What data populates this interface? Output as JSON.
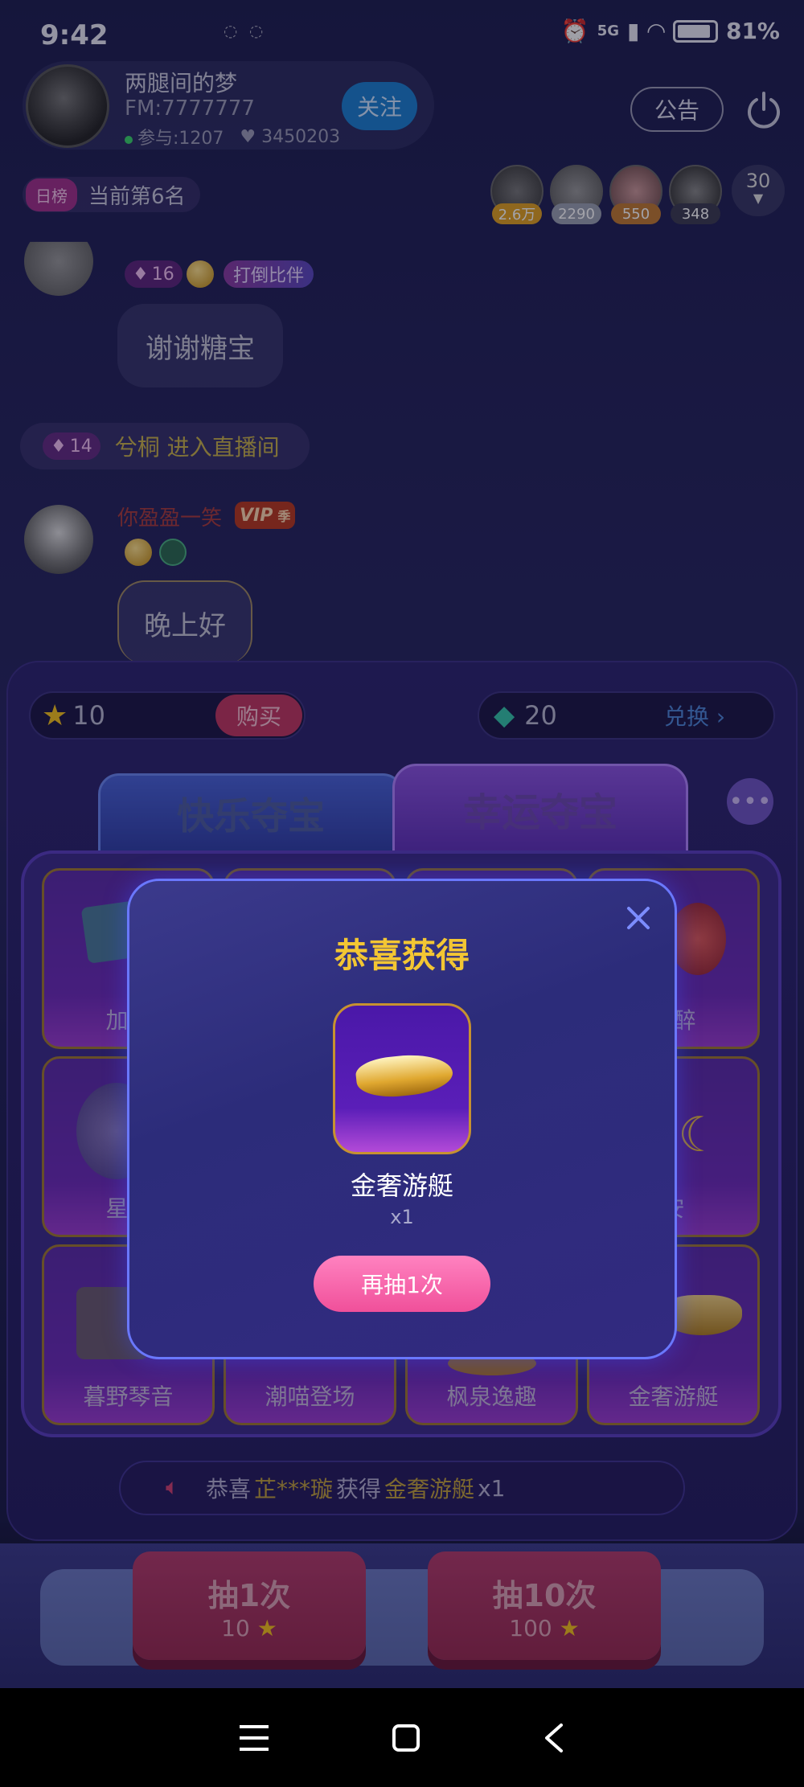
{
  "status_bar": {
    "time": "9:42",
    "network": "5G",
    "battery": "81%"
  },
  "host": {
    "name": "两腿间的梦",
    "fm": "FM:7777777",
    "participants": "参与:1207",
    "likes": "3450203",
    "follow_label": "关注"
  },
  "header": {
    "notice_label": "公告"
  },
  "rank": {
    "tag": "日榜",
    "text": "当前第6名"
  },
  "viewers": [
    {
      "badge": "2.6万",
      "badge_color": "#e0a020"
    },
    {
      "badge": "2290",
      "badge_color": "#9aa0b0"
    },
    {
      "badge": "550",
      "badge_color": "#c07a30"
    },
    {
      "badge": "348",
      "badge_color": "#3a3a50"
    }
  ],
  "online_count": "30",
  "chat": {
    "msg1": {
      "level": "16",
      "chip": "打倒比伴",
      "text": "谢谢糖宝"
    },
    "enter": {
      "level": "14",
      "text": "兮桐 进入直播间"
    },
    "msg2": {
      "user": "你盈盈一笑",
      "vip": "VIP",
      "vip_season": "季",
      "text": "晚上好"
    }
  },
  "game": {
    "stars": "10",
    "buy_label": "购买",
    "gems": "20",
    "exchange_label": "兑换",
    "tabs": [
      "快乐夺宝",
      "幸运夺宝"
    ],
    "active_tab": "幸运夺宝",
    "grid_labels": [
      "加油",
      "",
      "",
      "花醉",
      "星空",
      "",
      "",
      "安",
      "暮野琴音",
      "潮喵登场",
      "枫泉逸趣",
      "金奢游艇"
    ],
    "broadcast": {
      "prefix": "恭喜",
      "user": "芷***璇",
      "mid": "获得",
      "prize": "金奢游艇",
      "qty": "x1"
    },
    "draw1": {
      "label": "抽1次",
      "cost": "10"
    },
    "draw10": {
      "label": "抽10次",
      "cost": "100"
    }
  },
  "modal": {
    "title": "恭喜获得",
    "prize_name": "金奢游艇",
    "qty": "x1",
    "again_label": "再抽1次"
  },
  "colors": {
    "accent_gold": "#f3c633",
    "accent_pink": "#f0509a",
    "panel_purple": "#2b236e"
  }
}
